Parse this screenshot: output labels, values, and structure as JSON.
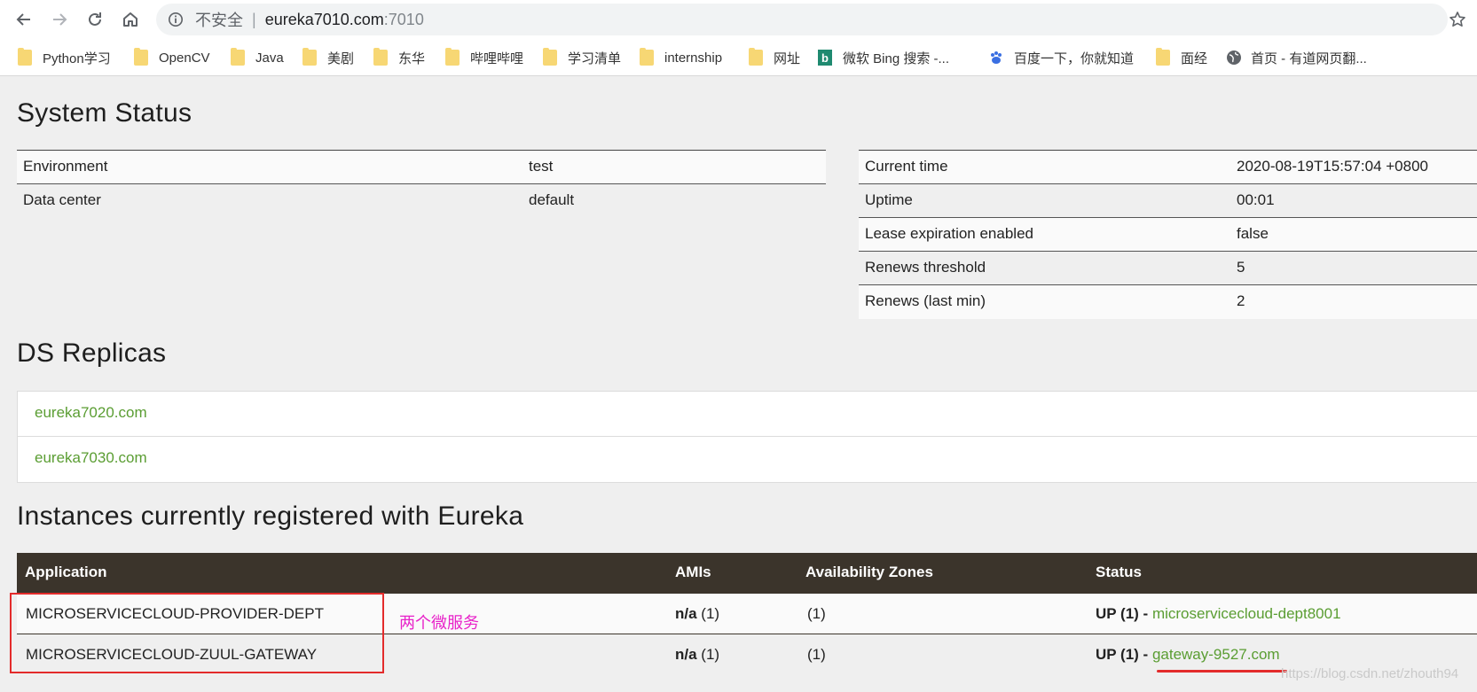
{
  "browser": {
    "address": {
      "security_label": "不安全",
      "separator": "|",
      "host": "eureka7010.com",
      "port": ":7010"
    },
    "bookmarks": [
      {
        "label": "Python学习",
        "icon": "folder-icon"
      },
      {
        "label": "OpenCV",
        "icon": "folder-icon"
      },
      {
        "label": "Java",
        "icon": "folder-icon"
      },
      {
        "label": "美剧",
        "icon": "folder-icon"
      },
      {
        "label": "东华",
        "icon": "folder-icon"
      },
      {
        "label": "哔哩哔哩",
        "icon": "folder-icon"
      },
      {
        "label": "学习清单",
        "icon": "folder-icon"
      },
      {
        "label": "internship",
        "icon": "folder-icon"
      },
      {
        "label": "网址",
        "icon": "folder-icon"
      },
      {
        "label": "微软 Bing 搜索 -...",
        "icon": "bing-icon"
      },
      {
        "label": "百度一下，你就知道",
        "icon": "baidu-paw-icon"
      },
      {
        "label": "面经",
        "icon": "folder-icon"
      },
      {
        "label": "首页 - 有道网页翻...",
        "icon": "globe-icon"
      }
    ]
  },
  "system_status": {
    "title": "System Status",
    "left": [
      {
        "key": "Environment",
        "value": "test"
      },
      {
        "key": "Data center",
        "value": "default"
      }
    ],
    "right": [
      {
        "key": "Current time",
        "value": "2020-08-19T15:57:04 +0800"
      },
      {
        "key": "Uptime",
        "value": "00:01"
      },
      {
        "key": "Lease expiration enabled",
        "value": "false"
      },
      {
        "key": "Renews threshold",
        "value": "5"
      },
      {
        "key": "Renews (last min)",
        "value": "2"
      }
    ]
  },
  "ds_replicas": {
    "title": "DS Replicas",
    "items": [
      "eureka7020.com",
      "eureka7030.com"
    ]
  },
  "instances": {
    "title": "Instances currently registered with Eureka",
    "headers": {
      "application": "Application",
      "amis": "AMIs",
      "zones": "Availability Zones",
      "status": "Status"
    },
    "rows": [
      {
        "application": "MICROSERVICECLOUD-PROVIDER-DEPT",
        "amis_bold": "n/a",
        "amis_count": "(1)",
        "zones": "(1)",
        "status_prefix": "UP (1) -",
        "status_link": "microservicecloud-dept8001"
      },
      {
        "application": "MICROSERVICECLOUD-ZUUL-GATEWAY",
        "amis_bold": "n/a",
        "amis_count": "(1)",
        "zones": "(1)",
        "status_prefix": "UP (1) -",
        "status_link": "gateway-9527.com"
      }
    ]
  },
  "annotation": {
    "text": "两个微服务",
    "color": "#e822c9",
    "box_color": "#e32b2b"
  },
  "watermark": "https://blog.csdn.net/zhouth94",
  "colors": {
    "link": "#5a9d32",
    "table_header_bg": "#3b342b",
    "page_bg": "#efefef"
  }
}
